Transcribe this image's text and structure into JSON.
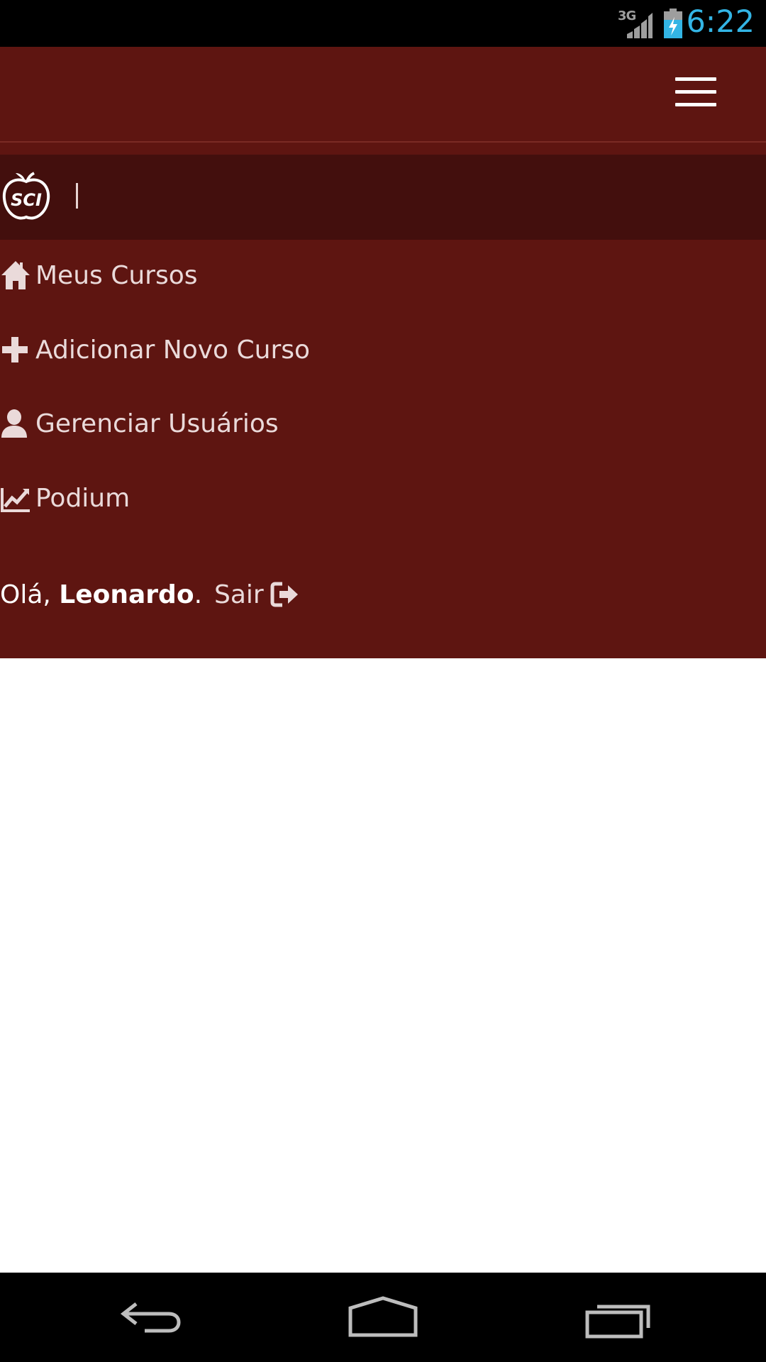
{
  "status_bar": {
    "network": "3G",
    "time": "6:22",
    "time_color": "#33b5e5"
  },
  "header": {
    "menu_icon": "hamburger-icon",
    "background": "#5e1511"
  },
  "brand": {
    "logo_text": "SCI",
    "logo_icon": "apple-logo-icon"
  },
  "nav": {
    "items": [
      {
        "label": "Meus Cursos",
        "icon": "home-icon"
      },
      {
        "label": "Adicionar Novo Curso",
        "icon": "plus-icon"
      },
      {
        "label": "Gerenciar Usuários",
        "icon": "user-icon"
      },
      {
        "label": "Podium",
        "icon": "chart-line-icon"
      }
    ]
  },
  "greeting": {
    "prefix": "Olá,",
    "user_name": "Leonardo",
    "suffix": "."
  },
  "logout": {
    "label": "Sair",
    "icon": "sign-out-icon"
  },
  "android_nav": {
    "back_icon": "back-icon",
    "home_icon": "home-button-icon",
    "recent_icon": "recent-apps-icon"
  }
}
